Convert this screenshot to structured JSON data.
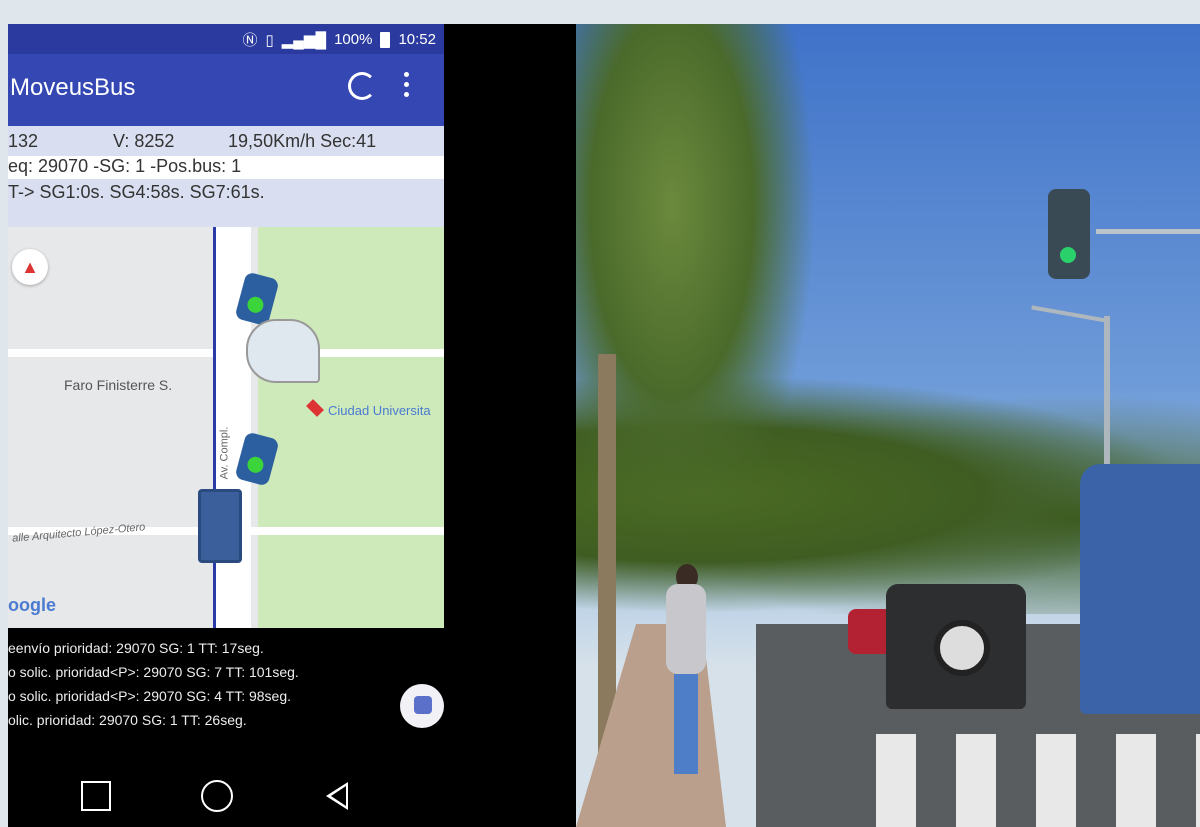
{
  "status_bar": {
    "battery": "100%",
    "time": "10:52"
  },
  "app": {
    "title": "MoveusBus"
  },
  "info": {
    "line1_a": "132",
    "line1_b": "V: 8252",
    "line1_c": "19,50Km/h",
    "line1_d": "Sec:41",
    "line2": "eq: 29070 -SG: 1 -Pos.bus: 1",
    "line3": "T-> SG1:0s.  SG4:58s.  SG7:61s."
  },
  "map": {
    "place": "Faro Finisterre S.",
    "metro": "Ciudad Universita",
    "street": "alle Arquitecto López-Otero",
    "avenue": "Av. Compl.",
    "attribution": "oogle"
  },
  "log": [
    "eenvío prioridad: 29070 SG: 1 TT: 17seg.",
    "o solic. prioridad<P>: 29070 SG: 7 TT: 101seg.",
    "o solic. prioridad<P>: 29070 SG: 4 TT: 98seg.",
    "olic. prioridad: 29070 SG: 1 TT: 26seg."
  ],
  "icons": {
    "refresh": "refresh-icon",
    "menu": "more-vertical-icon",
    "compass": "compass-icon",
    "traffic_light": "traffic-light-icon",
    "bus_stop": "bus-stop-icon",
    "bus": "bus-icon",
    "nav_recents": "square-icon",
    "nav_home": "circle-icon",
    "nav_back": "triangle-back-icon"
  },
  "colors": {
    "app_bar": "#3447b3",
    "status_bar": "#2a3a9e",
    "signal_green": "#3bd43b"
  }
}
